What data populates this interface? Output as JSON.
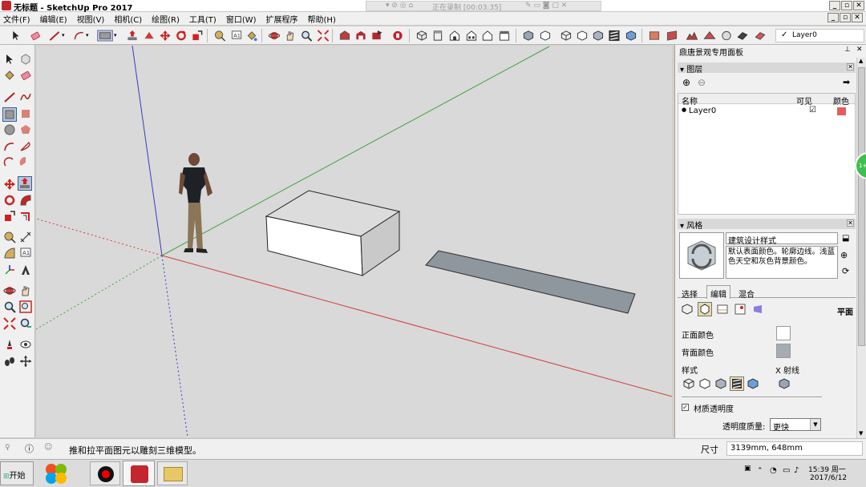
{
  "window": {
    "title": "无标题 - SketchUp Pro 2017",
    "recording_status": "正在录制 [00:03:35]"
  },
  "menu": [
    "文件(F)",
    "编辑(E)",
    "视图(V)",
    "相机(C)",
    "绘图(R)",
    "工具(T)",
    "窗口(W)",
    "扩展程序",
    "帮助(H)"
  ],
  "layer_select": {
    "value": "Layer0"
  },
  "tray": {
    "title": "鼎唐景观专用面板",
    "layers": {
      "header": "图层",
      "columns": {
        "name": "名称",
        "visible": "可见",
        "color": "颜色"
      },
      "rows": [
        {
          "name": "Layer0",
          "visible": "☑",
          "color": "#e35d5d"
        }
      ]
    },
    "styles": {
      "header": "风格",
      "style_name": "建筑设计样式",
      "style_desc": "默认表面颜色。轮廓边线。浅蓝色天空和灰色背景颜色。",
      "tabs": [
        "选择",
        "编辑",
        "混合"
      ],
      "mode_label": "平面",
      "front_color_label": "正面颜色",
      "back_color_label": "背面颜色",
      "front_color": "#ffffff",
      "back_color": "#a7acb3",
      "style_label": "样式",
      "xray_label": "X 射线",
      "transparency_label": "材质透明度",
      "transparency_quality_label": "透明度质量:",
      "transparency_quality_value": "更快"
    }
  },
  "status": {
    "hint": "推和拉平面图元以雕刻三维模型。",
    "measure_label": "尺寸",
    "measure_value": "3139mm, 648mm"
  },
  "taskbar": {
    "start_label": "开始",
    "time": "15:39 周一",
    "date": "2017/6/12"
  },
  "colors": {
    "axis_red": "#d23c3c",
    "axis_green": "#3fa33f",
    "axis_blue": "#3b3bc0",
    "background": "#d9d9d9"
  }
}
